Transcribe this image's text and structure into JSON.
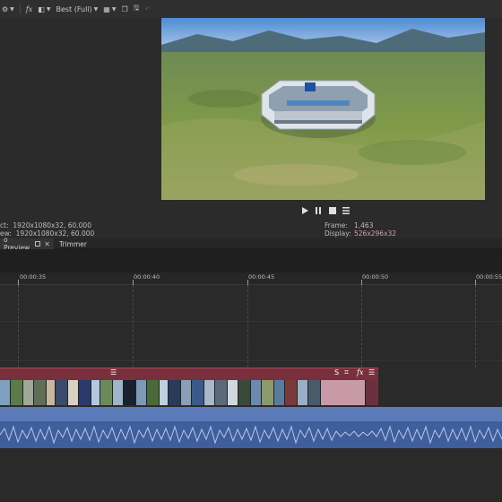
{
  "toolbar": {
    "fx_label": "fx",
    "quality_label": "Best (Full)"
  },
  "info": {
    "project_label": "ct:",
    "project_value": "1920x1080x32, 60.000",
    "preview_label": "ew:",
    "preview_value": "1920x1080x32, 60.000",
    "frame_label": "Frame:",
    "frame_value": "1,463",
    "display_label": "Display:",
    "display_value": "526x296x32"
  },
  "tabs": [
    {
      "label": "o Preview"
    },
    {
      "label": "Trimmer"
    }
  ],
  "ruler": [
    {
      "label": "00:00:35"
    },
    {
      "label": "00:00:40"
    },
    {
      "label": "00:00:45"
    },
    {
      "label": "00:00:50"
    },
    {
      "label": "00:00:55"
    }
  ],
  "clip": {
    "menu_glyph": "☰",
    "end_label": "S"
  },
  "colors": {
    "clip_header": "#7a2f3d",
    "audio": "#3f5f9c",
    "pink_text": "#d9a0a8"
  }
}
